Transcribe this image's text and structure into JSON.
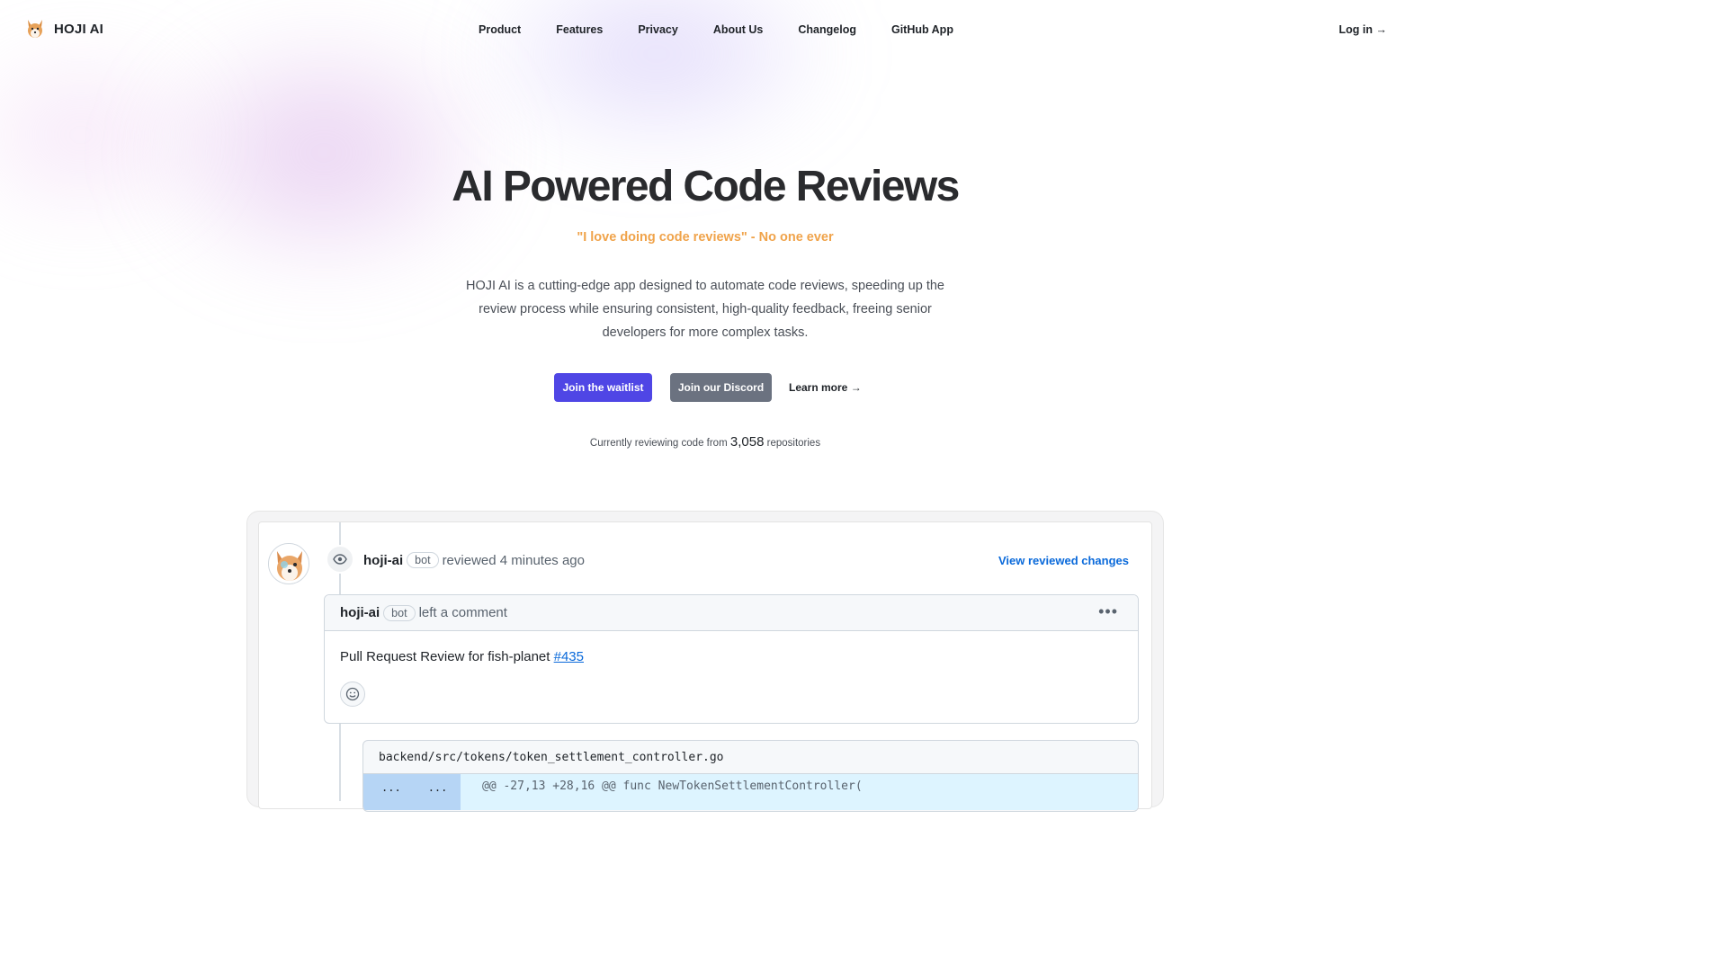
{
  "brand": {
    "name": "HOJI AI"
  },
  "nav": {
    "links": [
      "Product",
      "Features",
      "Privacy",
      "About Us",
      "Changelog",
      "GitHub App"
    ],
    "login": "Log in →"
  },
  "hero": {
    "title": "AI Powered Code Reviews",
    "quote": "\"I love doing code reviews\" - No one ever",
    "description": "HOJI AI is a cutting-edge app designed to automate code reviews, speeding up the review process while ensuring consistent, high-quality feedback, freeing senior developers for more complex tasks.",
    "cta_primary": "Join the waitlist",
    "cta_secondary": "Join our Discord",
    "cta_link": "Learn more →",
    "stat_prefix": "Currently reviewing code from",
    "stat_value": "3,058",
    "stat_suffix": "repositories"
  },
  "review": {
    "username": "hoji-ai",
    "bot_label": "bot",
    "action": "reviewed 4 minutes ago",
    "view_changes": "View reviewed changes",
    "comment_user": "hoji-ai",
    "comment_bot_label": "bot",
    "comment_action": "left a comment",
    "comment_text": "Pull Request Review for fish-planet",
    "pr_number": "#435",
    "file_path": "backend/src/tokens/token_settlement_controller.go",
    "gutter_left": "...",
    "gutter_right": "...",
    "hunk_header": "@@ -27,13 +28,16 @@ func NewTokenSettlementController("
  },
  "colors": {
    "primary": "#4f46e5",
    "secondary": "#6b7280",
    "quote": "#f0a34a",
    "link": "#0969da"
  }
}
